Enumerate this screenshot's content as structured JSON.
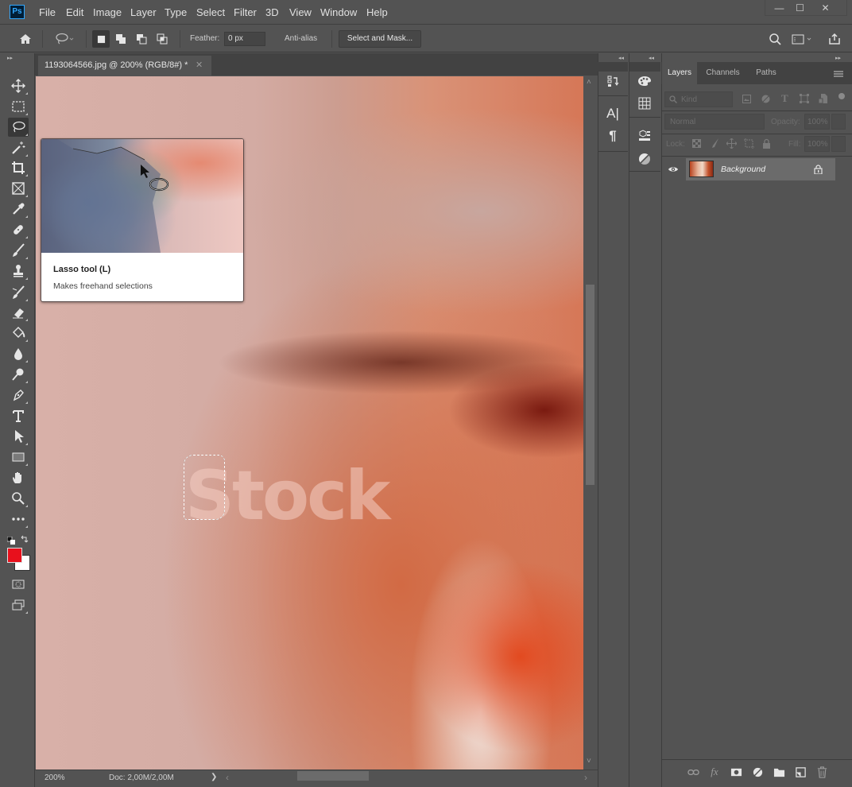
{
  "app": {
    "logo": "Ps"
  },
  "menu": [
    "File",
    "Edit",
    "Image",
    "Layer",
    "Type",
    "Select",
    "Filter",
    "3D",
    "View",
    "Window",
    "Help"
  ],
  "window_controls": {
    "minimize": "—",
    "maximize": "☐",
    "close": "✕"
  },
  "options_bar": {
    "feather_label": "Feather:",
    "feather_value": "0 px",
    "antialias_label": "Anti-alias",
    "antialias_checked": true,
    "select_and_mask_label": "Select and Mask...",
    "selection_modes": [
      "new-selection",
      "add-to-selection",
      "subtract-from-selection",
      "intersect-with-selection"
    ],
    "active_selection_mode": "new-selection"
  },
  "document": {
    "tab_title": "1193064566.jpg @ 200% (RGB/8#) *",
    "close_glyph": "✕",
    "watermark_text": "Stock",
    "zoom": "200%",
    "doc_info": "Doc: 2,00M/2,00M",
    "status_arrow": "❯",
    "hscroll_left": "‹",
    "hscroll_right": "›",
    "vscroll_up": "˄",
    "vscroll_down": "˅"
  },
  "tooltip": {
    "title": "Lasso tool (L)",
    "description": "Makes freehand selections"
  },
  "tools": [
    {
      "name": "move-tool"
    },
    {
      "name": "rectangular-marquee-tool"
    },
    {
      "name": "lasso-tool",
      "active": true
    },
    {
      "name": "magic-wand-tool"
    },
    {
      "name": "crop-tool"
    },
    {
      "name": "frame-tool"
    },
    {
      "name": "eyedropper-tool"
    },
    {
      "name": "healing-brush-tool"
    },
    {
      "name": "brush-tool"
    },
    {
      "name": "clone-stamp-tool"
    },
    {
      "name": "history-brush-tool"
    },
    {
      "name": "eraser-tool"
    },
    {
      "name": "paint-bucket-tool"
    },
    {
      "name": "blur-tool"
    },
    {
      "name": "dodge-tool"
    },
    {
      "name": "pen-tool"
    },
    {
      "name": "type-tool"
    },
    {
      "name": "path-selection-tool"
    },
    {
      "name": "rectangle-tool"
    },
    {
      "name": "hand-tool"
    },
    {
      "name": "zoom-tool"
    },
    {
      "name": "edit-toolbar"
    }
  ],
  "colors": {
    "foreground": "#e8101c",
    "background": "#ffffff",
    "accent": "#31a8ff",
    "ui_bg": "#535353"
  },
  "layers_panel": {
    "tabs": [
      "Layers",
      "Channels",
      "Paths"
    ],
    "active_tab": "Layers",
    "filter_placeholder": "Kind",
    "blend_mode": "Normal",
    "opacity_label": "Opacity:",
    "opacity_value": "100%",
    "lock_label": "Lock:",
    "fill_label": "Fill:",
    "fill_value": "100%",
    "layers": [
      {
        "name": "Background",
        "visible": true,
        "locked": true
      }
    ]
  },
  "collapsed_panels": {
    "column1": [
      "history-panel",
      "character-panel",
      "paragraph-panel"
    ],
    "column2": [
      "color-panel",
      "swatches-panel",
      "libraries-panel",
      "adjustments-panel"
    ],
    "character_glyph": "A|",
    "paragraph_glyph": "¶"
  }
}
